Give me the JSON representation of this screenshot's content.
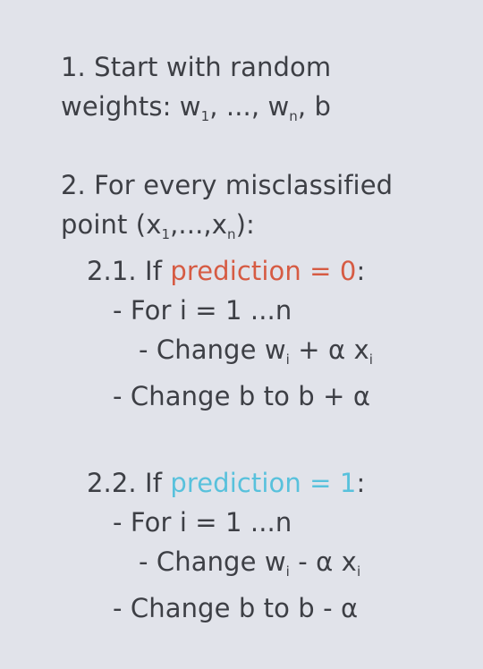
{
  "colors": {
    "background": "#e1e3ea",
    "text": "#3d3f45",
    "prediction_zero": "#d65b43",
    "prediction_one": "#58c1dc"
  },
  "step1": {
    "line1": "1. Start with random",
    "line2_prefix": "weights: w",
    "w1_sub": "1",
    "line2_mid": ", ..., w",
    "wn_sub": "n",
    "line2_suffix": ", b"
  },
  "step2": {
    "line1": "2. For every misclassified",
    "line2_prefix": "point (x",
    "x1_sub": "1",
    "line2_mid": ",...,x",
    "xn_sub": "n",
    "line2_suffix": "):"
  },
  "case_zero": {
    "prefix": "2.1. If ",
    "condition": "prediction = 0",
    "suffix": ":",
    "loop": "- For i = 1 ...n",
    "change_w_prefix": "- Change w",
    "w_sub": "i",
    "change_w_op": " + α x",
    "x_sub": "i",
    "change_b": "- Change b to b + α"
  },
  "case_one": {
    "prefix": "2.2. If ",
    "condition": "prediction = 1",
    "suffix": ":",
    "loop": "- For i = 1 ...n",
    "change_w_prefix": "- Change w",
    "w_sub": "i",
    "change_w_op": " - α x",
    "x_sub": "i",
    "change_b": "- Change b to b - α"
  }
}
